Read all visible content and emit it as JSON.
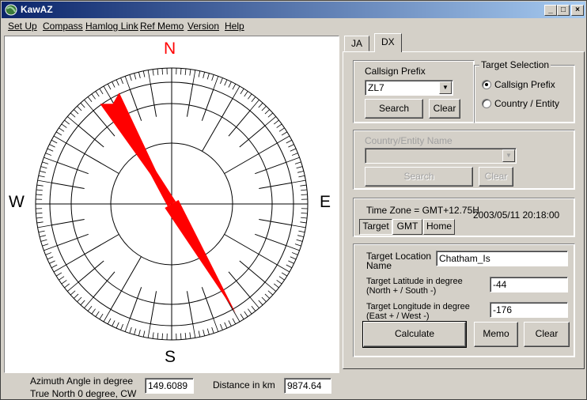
{
  "window": {
    "title": "KawAZ"
  },
  "titlebar_buttons": {
    "minimize": "_",
    "maximize": "□",
    "close": "×"
  },
  "menu": [
    "Set Up",
    "Compass",
    "Hamlog Link",
    "Ref Memo",
    "Version",
    "Help"
  ],
  "compass": {
    "north": "N",
    "south": "S",
    "east": "E",
    "west": "W",
    "azimuth_deg": 149.6089,
    "needle_color": "#ff0000",
    "north_color": "#ff0000"
  },
  "bottom": {
    "azimuth_label_1": "Azimuth Angle in degree",
    "azimuth_label_2": "True North 0 degree, CW",
    "azimuth_value": "149.6089",
    "distance_label": "Distance in km",
    "distance_value": "9874.64"
  },
  "tabs": [
    {
      "label": "JA",
      "active": false
    },
    {
      "label": "DX",
      "active": true
    }
  ],
  "callsign_group": {
    "title": "Callsign Prefix",
    "value": "ZL7",
    "search": "Search",
    "clear": "Clear"
  },
  "target_selection": {
    "title": "Target Selection",
    "option1": "Callsign Prefix",
    "option2": "Country / Entity",
    "selected": "Callsign Prefix"
  },
  "country_group": {
    "title": "Country/Entity Name",
    "value": "",
    "search": "Search",
    "clear": "Clear"
  },
  "timezone": {
    "label": "Time Zone = GMT+12.75H",
    "datetime": "2003/05/11 20:18:00",
    "buttons": [
      "Target",
      "GMT",
      "Home"
    ],
    "selected": "Target"
  },
  "target": {
    "location_label_1": "Target Location",
    "location_label_2": "Name",
    "location_value": "Chatham_Is",
    "lat_label_1": "Target Latitude in degree",
    "lat_label_2": "(North + / South -)",
    "lat_value": "-44",
    "lon_label_1": "Target Longitude in degree",
    "lon_label_2": "(East + / West -)",
    "lon_value": "-176",
    "calculate": "Calculate",
    "memo": "Memo",
    "clear": "Clear"
  }
}
